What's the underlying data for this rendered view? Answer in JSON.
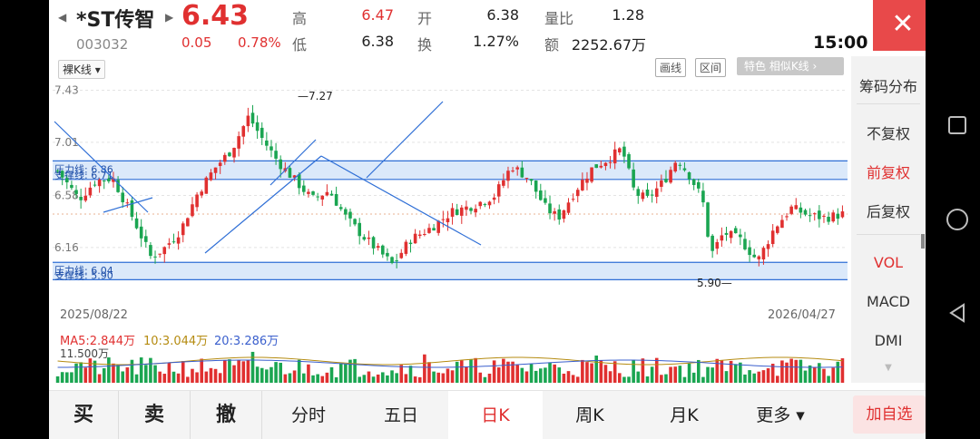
{
  "stock": {
    "name": "*ST传智",
    "code": "003032",
    "price": "6.43",
    "change": "0.05",
    "change_pct": "0.78%",
    "time": "15:00"
  },
  "quote": {
    "high_label": "高",
    "high": "6.47",
    "low_label": "低",
    "low": "6.38",
    "open_label": "开",
    "open": "6.38",
    "turnover_label": "换",
    "turnover": "1.27%",
    "vol_ratio_label": "量比",
    "vol_ratio": "1.28",
    "amount_label": "额",
    "amount": "2252.67万"
  },
  "toolbar": {
    "kline_mode": "裸K线",
    "draw_line": "画线",
    "range": "区间",
    "special": "特色  相似K线 ›"
  },
  "chart": {
    "yticks": [
      "7.43",
      "7.01",
      "6.58",
      "6.16"
    ],
    "pressure1_label": "压力线: 6.86",
    "support1_label": "支撑线: 6.71",
    "pressure2_label": "压力线: 6.04",
    "support2_label": "支撑线: 5.90",
    "high_marker": "7.27",
    "low_marker": "5.90",
    "start_date": "2025/08/22",
    "end_date": "2026/04/27"
  },
  "ma": {
    "ma5": "MA5:2.844万",
    "ma10": "10:3.044万",
    "ma20": "20:3.286万",
    "vol_max": "11.500万"
  },
  "right_panel": {
    "chip": "筹码分布",
    "no_adj": "不复权",
    "fwd_adj": "前复权",
    "back_adj": "后复权",
    "vol": "VOL",
    "macd": "MACD",
    "dmi": "DMI"
  },
  "bottom": {
    "buy": "买",
    "sell": "卖",
    "cancel": "撤",
    "intraday": "分时",
    "five_day": "五日",
    "daily_k": "日K",
    "weekly_k": "周K",
    "monthly_k": "月K",
    "more": "更多 ▾",
    "add_fav": "加自选"
  },
  "colors": {
    "up": "#e03030",
    "down": "#1aa551",
    "band": "#cfe2f8",
    "band_line": "#2f6fd6",
    "trendline": "#2f6fd6"
  }
}
